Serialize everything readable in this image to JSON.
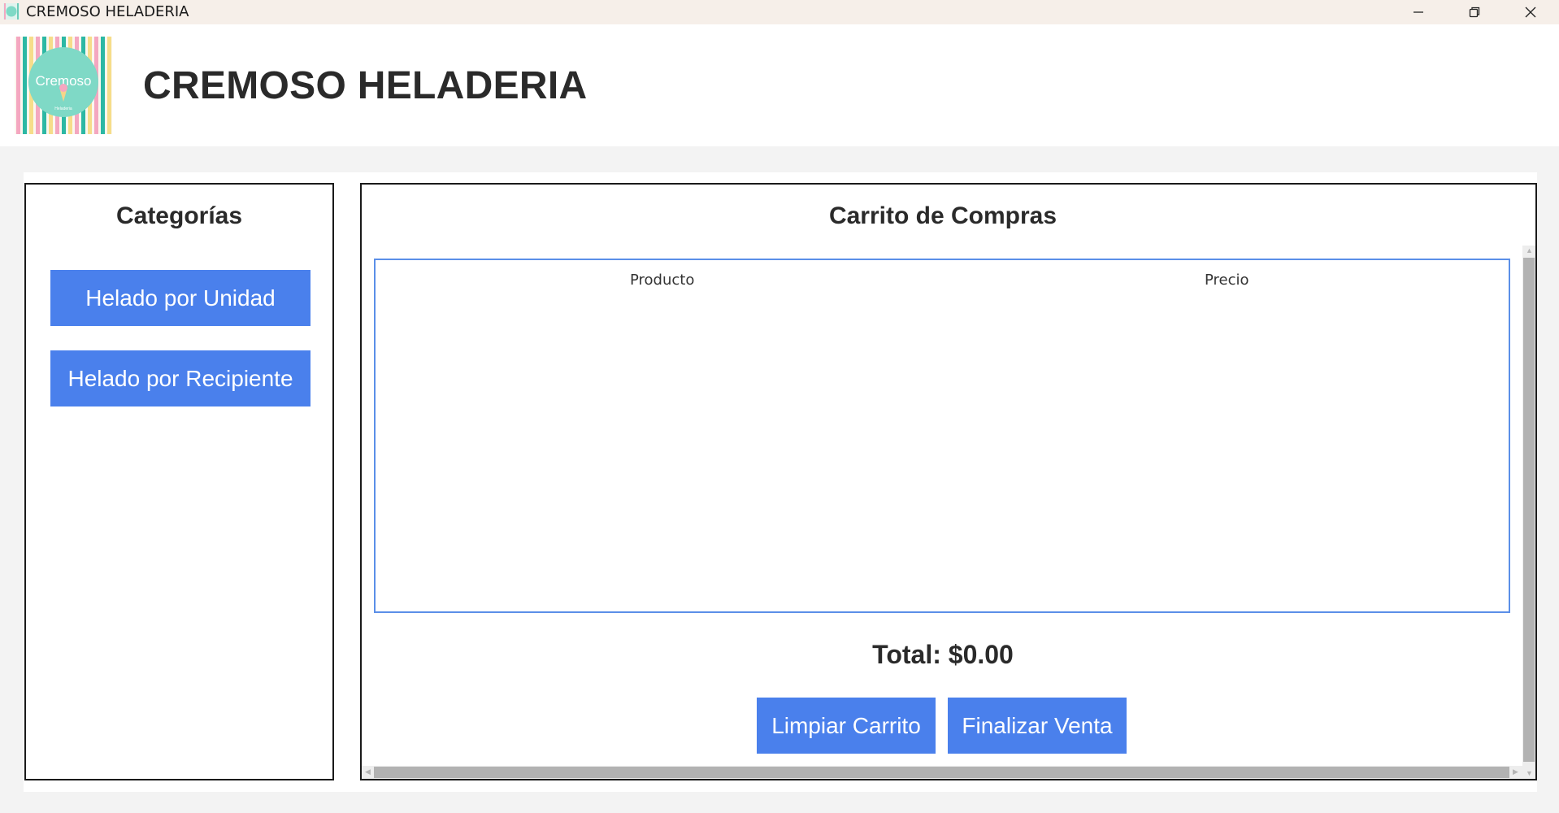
{
  "window": {
    "title": "CREMOSO HELADERIA",
    "controls": [
      "minimize",
      "restore",
      "close"
    ]
  },
  "header": {
    "title": "CREMOSO HELADERIA",
    "logo_text": "Cremoso",
    "logo_subtext": "Heladeria"
  },
  "categories": {
    "title": "Categorías",
    "buttons": [
      "Helado por Unidad",
      "Helado por Recipiente"
    ]
  },
  "cart": {
    "title": "Carrito de Compras",
    "columns": [
      "Producto",
      "Precio"
    ],
    "rows": [],
    "total_label": "Total: $0.00",
    "clear_label": "Limpiar Carrito",
    "checkout_label": "Finalizar Venta"
  },
  "colors": {
    "button": "#4a80ec",
    "title_bar": "#f6efe9",
    "logo_circle": "#7fd9c6"
  }
}
